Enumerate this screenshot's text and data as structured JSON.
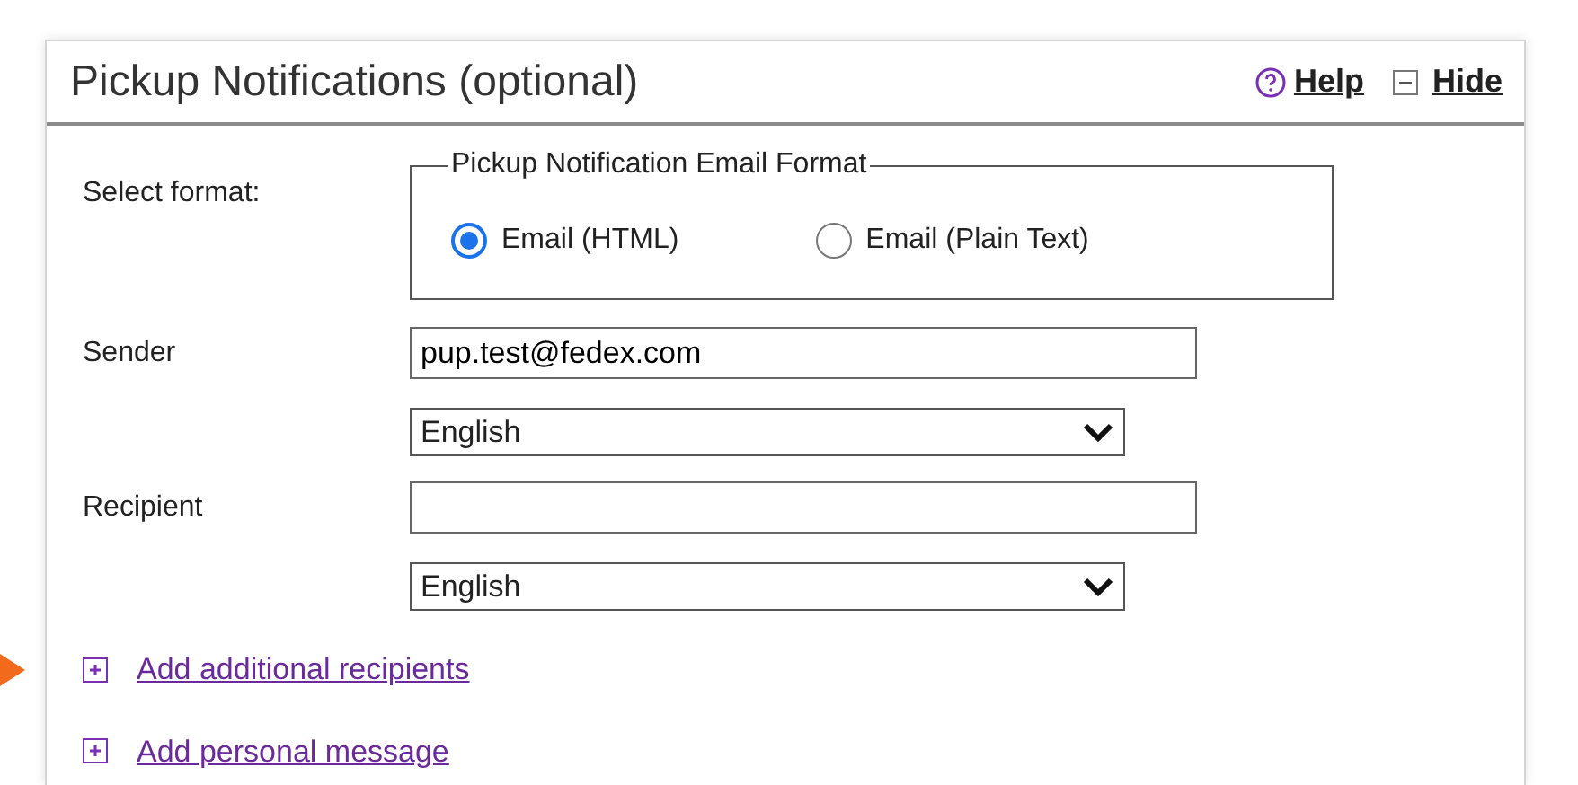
{
  "panel": {
    "title": "Pickup Notifications (optional)",
    "help": "Help",
    "hide": "Hide"
  },
  "format": {
    "label": "Select format:",
    "legend": "Pickup Notification Email Format",
    "options": [
      {
        "label": "Email (HTML)",
        "selected": true
      },
      {
        "label": "Email (Plain Text)",
        "selected": false
      }
    ]
  },
  "fields": [
    {
      "label": "Sender",
      "value": "pup.test@fedex.com",
      "language": "English"
    },
    {
      "label": "Recipient",
      "language": "English"
    }
  ],
  "links": [
    {
      "label": "Add additional recipients"
    },
    {
      "label": "Add personal message"
    }
  ]
}
